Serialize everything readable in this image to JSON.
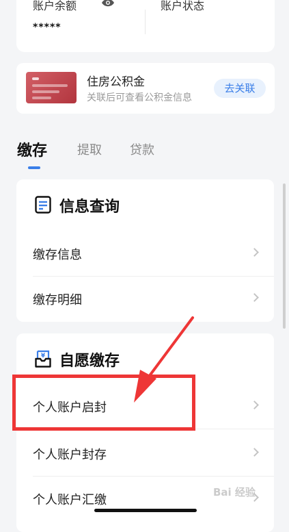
{
  "account": {
    "balance_label": "账户余额",
    "balance_value": "*****",
    "status_label": "账户状态"
  },
  "fund_card": {
    "title": "住房公积金",
    "subtitle": "关联后可查看公积金信息",
    "link_button": "去关联"
  },
  "tabs": [
    {
      "label": "缴存",
      "active": true
    },
    {
      "label": "提取",
      "active": false
    },
    {
      "label": "贷款",
      "active": false
    }
  ],
  "sections": [
    {
      "title": "信息查询",
      "icon": "document-icon",
      "items": [
        "缴存信息",
        "缴存明细"
      ]
    },
    {
      "title": "自愿缴存",
      "icon": "inbox-yuan-icon",
      "items": [
        "个人账户启封",
        "个人账户封存",
        "个人账户汇缴"
      ]
    }
  ],
  "watermark": "Bai 经验",
  "colors": {
    "accent": "#3a7ee8",
    "annotation": "#ee3636"
  }
}
